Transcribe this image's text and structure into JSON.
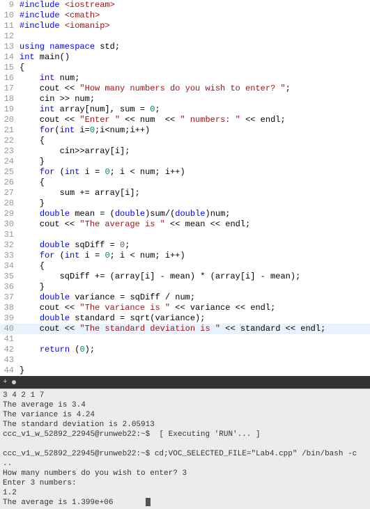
{
  "lines": [
    {
      "n": 9,
      "segs": [
        {
          "t": "#include ",
          "c": "pp"
        },
        {
          "t": "<iostream>",
          "c": "inc"
        }
      ]
    },
    {
      "n": 10,
      "segs": [
        {
          "t": "#include ",
          "c": "pp"
        },
        {
          "t": "<cmath>",
          "c": "inc"
        }
      ]
    },
    {
      "n": 11,
      "segs": [
        {
          "t": "#include ",
          "c": "pp"
        },
        {
          "t": "<iomanip>",
          "c": "inc"
        }
      ]
    },
    {
      "n": 12,
      "segs": []
    },
    {
      "n": 13,
      "segs": [
        {
          "t": "using namespace",
          "c": "kw"
        },
        {
          "t": " std;",
          "c": ""
        }
      ]
    },
    {
      "n": 14,
      "segs": [
        {
          "t": "int",
          "c": "type"
        },
        {
          "t": " main()",
          "c": ""
        }
      ]
    },
    {
      "n": 15,
      "segs": [
        {
          "t": "{",
          "c": ""
        }
      ]
    },
    {
      "n": 16,
      "segs": [
        {
          "t": "    ",
          "c": ""
        },
        {
          "t": "int",
          "c": "type"
        },
        {
          "t": " num;",
          "c": ""
        }
      ]
    },
    {
      "n": 17,
      "segs": [
        {
          "t": "    cout << ",
          "c": ""
        },
        {
          "t": "\"How many numbers do you wish to enter? \"",
          "c": "str"
        },
        {
          "t": ";",
          "c": ""
        }
      ]
    },
    {
      "n": 18,
      "segs": [
        {
          "t": "    cin >> num;",
          "c": ""
        }
      ]
    },
    {
      "n": 19,
      "segs": [
        {
          "t": "    ",
          "c": ""
        },
        {
          "t": "int",
          "c": "type"
        },
        {
          "t": " array[num], sum = ",
          "c": ""
        },
        {
          "t": "0",
          "c": "num"
        },
        {
          "t": ";",
          "c": ""
        }
      ]
    },
    {
      "n": 20,
      "segs": [
        {
          "t": "    cout << ",
          "c": ""
        },
        {
          "t": "\"Enter \"",
          "c": "str"
        },
        {
          "t": " << num  << ",
          "c": ""
        },
        {
          "t": "\" numbers: \"",
          "c": "str"
        },
        {
          "t": " << endl;",
          "c": ""
        }
      ]
    },
    {
      "n": 21,
      "segs": [
        {
          "t": "    ",
          "c": ""
        },
        {
          "t": "for",
          "c": "kw"
        },
        {
          "t": "(",
          "c": ""
        },
        {
          "t": "int",
          "c": "type"
        },
        {
          "t": " i=",
          "c": ""
        },
        {
          "t": "0",
          "c": "num"
        },
        {
          "t": ";i<num;i++)",
          "c": ""
        }
      ]
    },
    {
      "n": 22,
      "segs": [
        {
          "t": "    {",
          "c": ""
        }
      ]
    },
    {
      "n": 23,
      "segs": [
        {
          "t": "        cin>>array[i];",
          "c": ""
        }
      ]
    },
    {
      "n": 24,
      "segs": [
        {
          "t": "    }",
          "c": ""
        }
      ]
    },
    {
      "n": 25,
      "segs": [
        {
          "t": "    ",
          "c": ""
        },
        {
          "t": "for",
          "c": "kw"
        },
        {
          "t": " (",
          "c": ""
        },
        {
          "t": "int",
          "c": "type"
        },
        {
          "t": " i = ",
          "c": ""
        },
        {
          "t": "0",
          "c": "num"
        },
        {
          "t": "; i < num; i++)",
          "c": ""
        }
      ]
    },
    {
      "n": 26,
      "segs": [
        {
          "t": "    {",
          "c": ""
        }
      ]
    },
    {
      "n": 27,
      "segs": [
        {
          "t": "        sum += array[i];",
          "c": ""
        }
      ]
    },
    {
      "n": 28,
      "segs": [
        {
          "t": "    }",
          "c": ""
        }
      ]
    },
    {
      "n": 29,
      "segs": [
        {
          "t": "    ",
          "c": ""
        },
        {
          "t": "double",
          "c": "type"
        },
        {
          "t": " mean = (",
          "c": ""
        },
        {
          "t": "double",
          "c": "type"
        },
        {
          "t": ")sum/(",
          "c": ""
        },
        {
          "t": "double",
          "c": "type"
        },
        {
          "t": ")num;",
          "c": ""
        }
      ]
    },
    {
      "n": 30,
      "segs": [
        {
          "t": "    cout << ",
          "c": ""
        },
        {
          "t": "\"The average is \"",
          "c": "str"
        },
        {
          "t": " << mean << endl;",
          "c": ""
        }
      ]
    },
    {
      "n": 31,
      "segs": []
    },
    {
      "n": 32,
      "segs": [
        {
          "t": "    ",
          "c": ""
        },
        {
          "t": "double",
          "c": "type"
        },
        {
          "t": " sqDiff = ",
          "c": ""
        },
        {
          "t": "0",
          "c": "num"
        },
        {
          "t": ";",
          "c": ""
        }
      ]
    },
    {
      "n": 33,
      "segs": [
        {
          "t": "    ",
          "c": ""
        },
        {
          "t": "for",
          "c": "kw"
        },
        {
          "t": " (",
          "c": ""
        },
        {
          "t": "int",
          "c": "type"
        },
        {
          "t": " i = ",
          "c": ""
        },
        {
          "t": "0",
          "c": "num"
        },
        {
          "t": "; i < num; i++)",
          "c": ""
        }
      ]
    },
    {
      "n": 34,
      "segs": [
        {
          "t": "    {",
          "c": ""
        }
      ]
    },
    {
      "n": 35,
      "segs": [
        {
          "t": "        sqDiff += (array[i] - mean) * (array[i] - mean);",
          "c": ""
        }
      ]
    },
    {
      "n": 36,
      "segs": [
        {
          "t": "    }",
          "c": ""
        }
      ]
    },
    {
      "n": 37,
      "segs": [
        {
          "t": "    ",
          "c": ""
        },
        {
          "t": "double",
          "c": "type"
        },
        {
          "t": " variance = sqDiff / num;",
          "c": ""
        }
      ]
    },
    {
      "n": 38,
      "segs": [
        {
          "t": "    cout << ",
          "c": ""
        },
        {
          "t": "\"The variance is \"",
          "c": "str"
        },
        {
          "t": " << variance << endl;",
          "c": ""
        }
      ]
    },
    {
      "n": 39,
      "segs": [
        {
          "t": "    ",
          "c": ""
        },
        {
          "t": "double",
          "c": "type"
        },
        {
          "t": " standard = sqrt(variance);",
          "c": ""
        }
      ]
    },
    {
      "n": 40,
      "hl": true,
      "segs": [
        {
          "t": "    cout << ",
          "c": ""
        },
        {
          "t": "\"The standard deviation is \"",
          "c": "str"
        },
        {
          "t": " << standard << endl;",
          "c": ""
        }
      ]
    },
    {
      "n": 41,
      "segs": []
    },
    {
      "n": 42,
      "segs": [
        {
          "t": "    ",
          "c": ""
        },
        {
          "t": "return",
          "c": "kw"
        },
        {
          "t": " (",
          "c": ""
        },
        {
          "t": "0",
          "c": "num"
        },
        {
          "t": ");",
          "c": ""
        }
      ]
    },
    {
      "n": 43,
      "segs": []
    },
    {
      "n": 44,
      "segs": [
        {
          "t": "}",
          "c": ""
        }
      ]
    }
  ],
  "terminal": {
    "part1": "3 4 2 1 7\nThe average is 3.4\nThe variance is 4.24\nThe standard deviation is 2.05913\nccc_v1_w_52892_22945@runweb22:~$  [ Executing 'RUN'... ]\n\nccc_v1_w_52892_22945@runweb22:~$ cd;VOC_SELECTED_FILE=\"Lab4.cpp\" /bin/bash -c ..\nHow many numbers do you wish to enter? 3\nEnter 3 numbers:\n1.2\nThe average is 1.399e+06       "
  },
  "tabbar": {
    "plus": "+"
  }
}
